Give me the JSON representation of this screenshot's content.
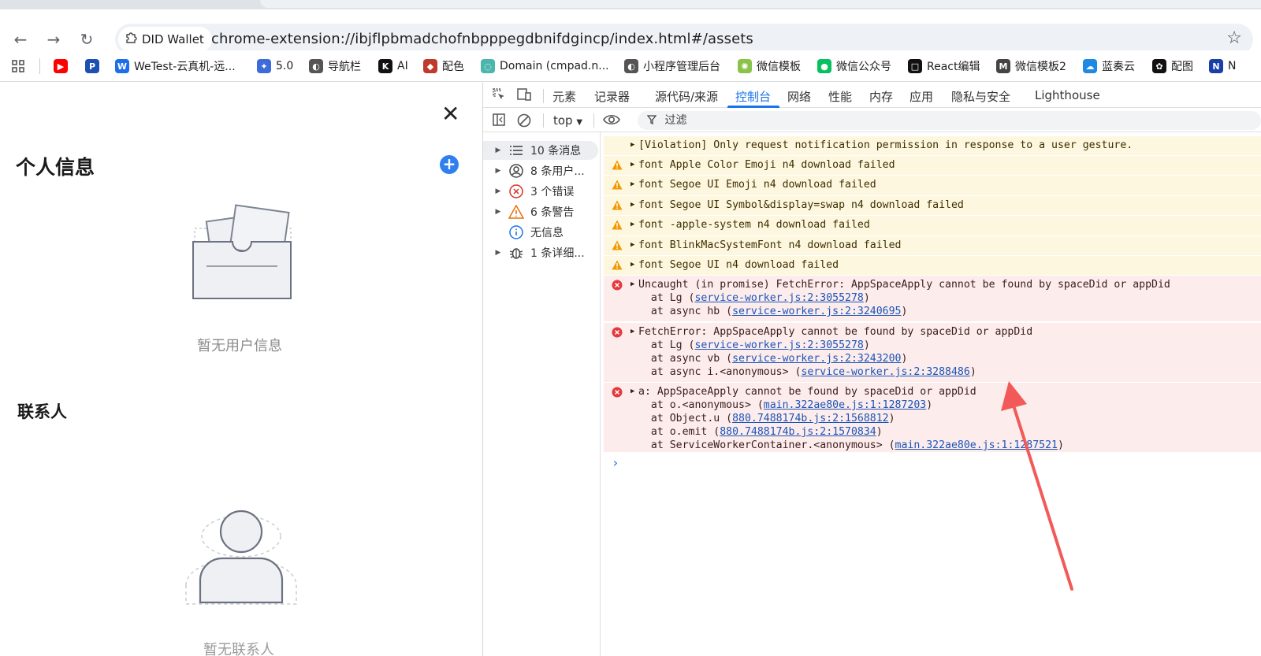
{
  "browser": {
    "chip_label": "DID Wallet",
    "url": "chrome-extension://ibjflpbmadchofnbpppegdbnifdgincp/index.html#/assets"
  },
  "bookmarks": [
    {
      "label": "",
      "icon": "youtube-icon",
      "color": "#ff0000"
    },
    {
      "label": "",
      "icon": "paypal-icon",
      "color": "#1e4fb3"
    },
    {
      "label": "WeTest-云真机-远...",
      "icon": "wetest-icon",
      "color": "#1c6fe8"
    },
    {
      "label": "5.0",
      "icon": "rocket-icon",
      "color": "#3d6bdb"
    },
    {
      "label": "导航栏",
      "icon": "globe-icon",
      "color": "#555555"
    },
    {
      "label": "AI",
      "icon": "k-icon",
      "color": "#111111"
    },
    {
      "label": "配色",
      "icon": "palette-icon",
      "color": "#c0392b"
    },
    {
      "label": "Domain (cmpad.n...",
      "icon": "domain-icon",
      "color": "#4db6ac"
    },
    {
      "label": "小程序管理后台",
      "icon": "globe-icon",
      "color": "#555555"
    },
    {
      "label": "微信模板",
      "icon": "sun-icon",
      "color": "#8bc34a"
    },
    {
      "label": "微信公众号",
      "icon": "wechat-icon",
      "color": "#07c160"
    },
    {
      "label": "React编辑",
      "icon": "square-icon",
      "color": "#111111"
    },
    {
      "label": "微信模板2",
      "icon": "m-icon",
      "color": "#444444"
    },
    {
      "label": "蓝奏云",
      "icon": "cloud-icon",
      "color": "#1e88e5"
    },
    {
      "label": "配图",
      "icon": "openai-icon",
      "color": "#111111"
    },
    {
      "label": "N",
      "icon": "n-icon",
      "color": "#1a3fa6"
    }
  ],
  "left_page": {
    "title": "个人信息",
    "empty_text": "暂无用户信息",
    "contacts_title": "联系人",
    "contacts_empty_partial": "暂无联系人"
  },
  "devtools": {
    "tabs": [
      "元素",
      "记录器",
      "源代码/来源",
      "控制台",
      "网络",
      "性能",
      "内存",
      "应用",
      "隐私与安全",
      "Lighthouse"
    ],
    "active_tab": "控制台",
    "context": "top",
    "filter_placeholder": "过滤",
    "sidebar": [
      {
        "label": "10 条消息",
        "icon": "list-icon"
      },
      {
        "label": "8 条用户...",
        "icon": "user-circle-icon"
      },
      {
        "label": "3 个错误",
        "icon": "error-icon"
      },
      {
        "label": "6 条警告",
        "icon": "warning-icon"
      },
      {
        "label": "无信息",
        "icon": "info-icon"
      },
      {
        "label": "1 条详细...",
        "icon": "bug-icon"
      }
    ],
    "messages": [
      {
        "type": "violation",
        "lines": [
          "[Violation] Only request notification permission in response to a user gesture."
        ]
      },
      {
        "type": "warning",
        "lines": [
          "font Apple Color Emoji n4 download failed"
        ]
      },
      {
        "type": "warning",
        "lines": [
          "font Segoe UI Emoji n4 download failed"
        ]
      },
      {
        "type": "warning",
        "lines": [
          "font Segoe UI Symbol&display=swap n4 download failed"
        ]
      },
      {
        "type": "warning",
        "lines": [
          "font -apple-system n4 download failed"
        ]
      },
      {
        "type": "warning",
        "lines": [
          "font BlinkMacSystemFont n4 download failed"
        ]
      },
      {
        "type": "warning",
        "lines": [
          "font Segoe UI n4 download failed"
        ]
      },
      {
        "type": "error",
        "lines": [
          {
            "text": "Uncaught (in promise) FetchError: AppSpaceApply cannot be found by spaceDid or appDid"
          },
          {
            "text": "  at Lg (",
            "link": "service-worker.js:2:3055278",
            "after": ")"
          },
          {
            "text": "  at async hb (",
            "link": "service-worker.js:2:3240695",
            "after": ")"
          }
        ]
      },
      {
        "type": "error",
        "lines": [
          {
            "text": "FetchError: AppSpaceApply cannot be found by spaceDid or appDid"
          },
          {
            "text": "  at Lg (",
            "link": "service-worker.js:2:3055278",
            "after": ")"
          },
          {
            "text": "  at async vb (",
            "link": "service-worker.js:2:3243200",
            "after": ")"
          },
          {
            "text": "  at async i.<anonymous> (",
            "link": "service-worker.js:2:3288486",
            "after": ")"
          }
        ]
      },
      {
        "type": "error",
        "lines": [
          {
            "text": "a: AppSpaceApply cannot be found by spaceDid or appDid"
          },
          {
            "text": "  at o.<anonymous> (",
            "link": "main.322ae80e.js:1:1287203",
            "after": ")"
          },
          {
            "text": "  at Object.u (",
            "link": "880.7488174b.js:2:1568812",
            "after": ")"
          },
          {
            "text": "  at o.emit (",
            "link": "880.7488174b.js:2:1570834",
            "after": ")"
          },
          {
            "text": "  at ServiceWorkerContainer.<anonymous> (",
            "link": "main.322ae80e.js:1:1287521",
            "after": ")"
          }
        ]
      }
    ],
    "prompt_symbol": "›"
  },
  "colors": {
    "accent": "#1a73e8",
    "warning_bg": "#fef7df",
    "error_bg": "#fdecec",
    "annotation_arrow": "#f25a5a"
  }
}
